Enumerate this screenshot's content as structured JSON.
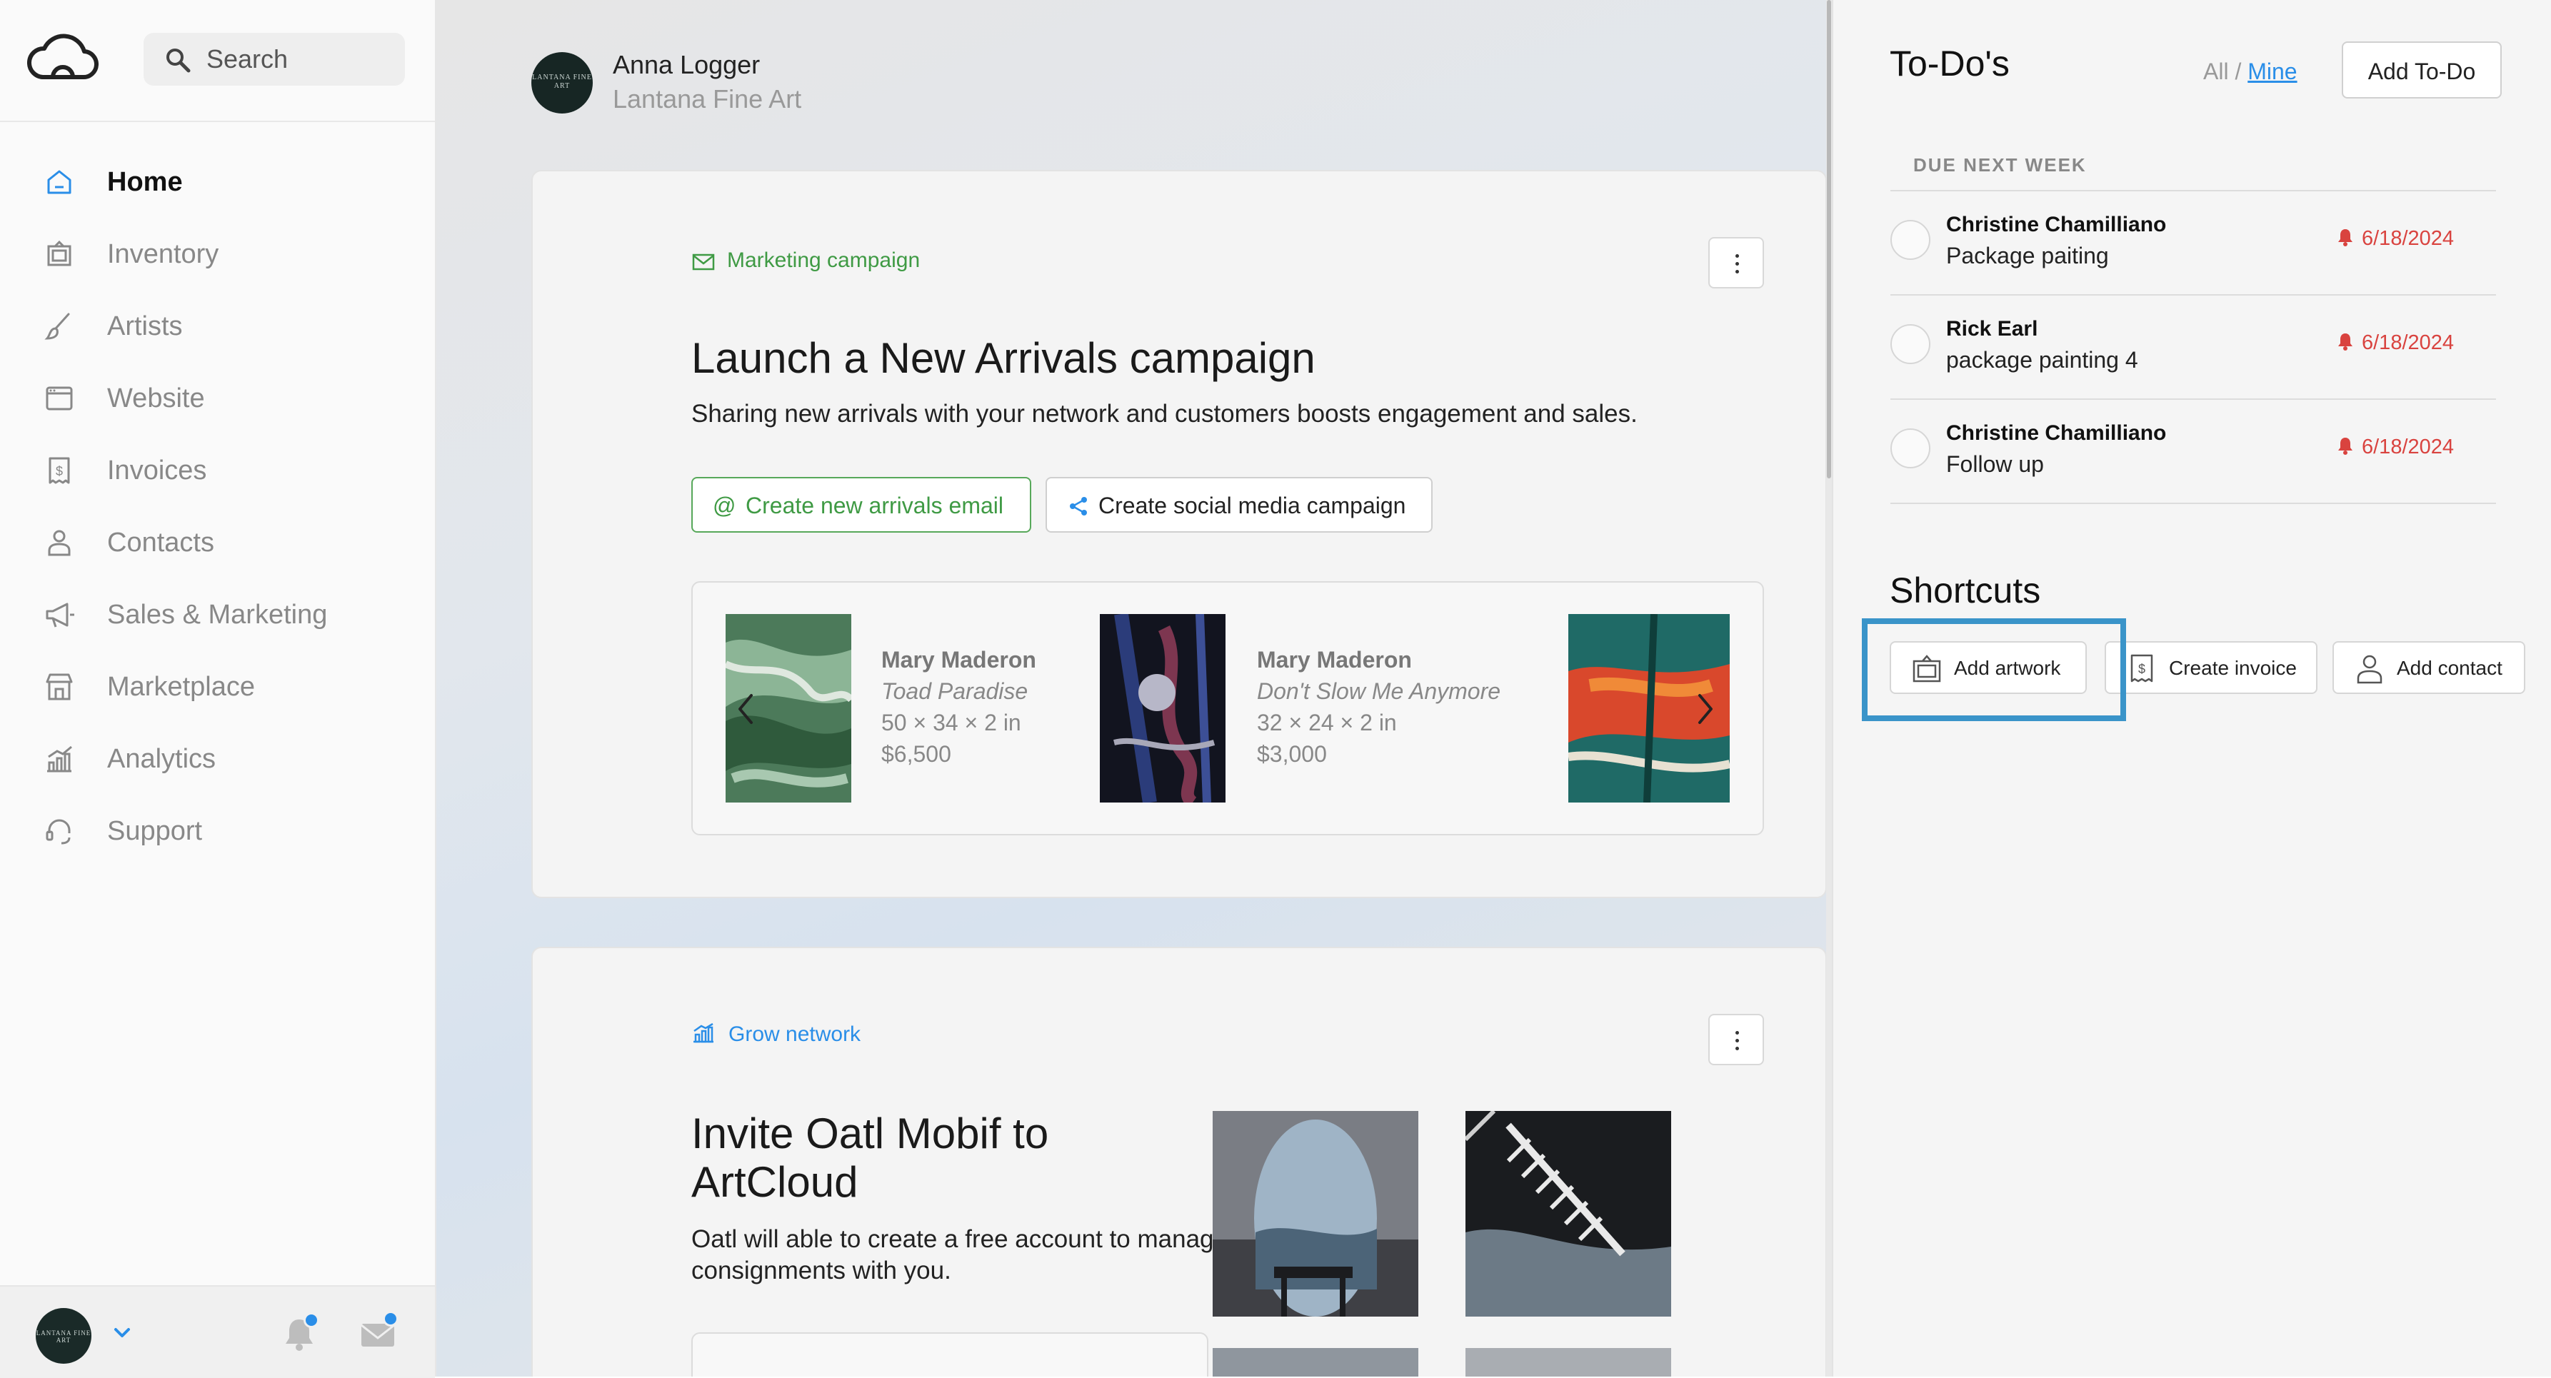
{
  "sidebar": {
    "search": {
      "placeholder": "Search"
    },
    "nav": [
      {
        "label": "Home",
        "icon": "home-icon",
        "active": true
      },
      {
        "label": "Inventory",
        "icon": "inventory-icon"
      },
      {
        "label": "Artists",
        "icon": "brush-icon"
      },
      {
        "label": "Website",
        "icon": "browser-icon"
      },
      {
        "label": "Invoices",
        "icon": "invoice-icon"
      },
      {
        "label": "Contacts",
        "icon": "person-icon"
      },
      {
        "label": "Sales & Marketing",
        "icon": "megaphone-icon"
      },
      {
        "label": "Marketplace",
        "icon": "store-icon"
      },
      {
        "label": "Analytics",
        "icon": "chart-icon"
      },
      {
        "label": "Support",
        "icon": "headset-icon"
      }
    ],
    "footer": {
      "avatar_text": "LANTANA FINE ART"
    }
  },
  "main": {
    "user": {
      "name": "Anna Logger",
      "org": "Lantana Fine Art",
      "avatar_text": "LANTANA FINE ART"
    },
    "campaign_card": {
      "kicker": "Marketing campaign",
      "title": "Launch a New Arrivals campaign",
      "description": "Sharing new arrivals with your network and customers boosts engagement and sales.",
      "primary_button": "Create new arrivals email",
      "secondary_button": "Create social media campaign",
      "artworks": [
        {
          "artist": "Mary Maderon",
          "title": "Toad Paradise",
          "dims": "50 × 34 × 2 in",
          "price": "$6,500"
        },
        {
          "artist": "Mary Maderon",
          "title": "Don't Slow Me Anymore",
          "dims": "32 × 24 × 2 in",
          "price": "$3,000"
        }
      ]
    },
    "network_card": {
      "kicker": "Grow network",
      "title": "Invite Oatl Mobif to ArtCloud",
      "description": "Oatl will able to create a free account to manage consignments with you."
    }
  },
  "right": {
    "todo_title": "To-Do's",
    "filter_all": "All",
    "filter_sep": " / ",
    "filter_mine": "Mine",
    "add_todo": "Add To-Do",
    "section_label": "DUE NEXT WEEK",
    "todos": [
      {
        "who": "Christine Chamilliano",
        "what": "Package paiting",
        "due": "6/18/2024"
      },
      {
        "who": "Rick Earl",
        "what": "package painting 4",
        "due": "6/18/2024"
      },
      {
        "who": "Christine Chamilliano",
        "what": "Follow up",
        "due": "6/18/2024"
      }
    ],
    "shortcuts_title": "Shortcuts",
    "shortcuts": [
      {
        "label": "Add artwork",
        "icon": "artwork-icon"
      },
      {
        "label": "Create invoice",
        "icon": "invoice-icon"
      },
      {
        "label": "Add contact",
        "icon": "person-icon"
      }
    ]
  },
  "colors": {
    "accent_blue": "#2a8ee8",
    "accent_green": "#3f9a44",
    "due_red": "#d9433f",
    "highlight_blue": "#3a94c9"
  }
}
